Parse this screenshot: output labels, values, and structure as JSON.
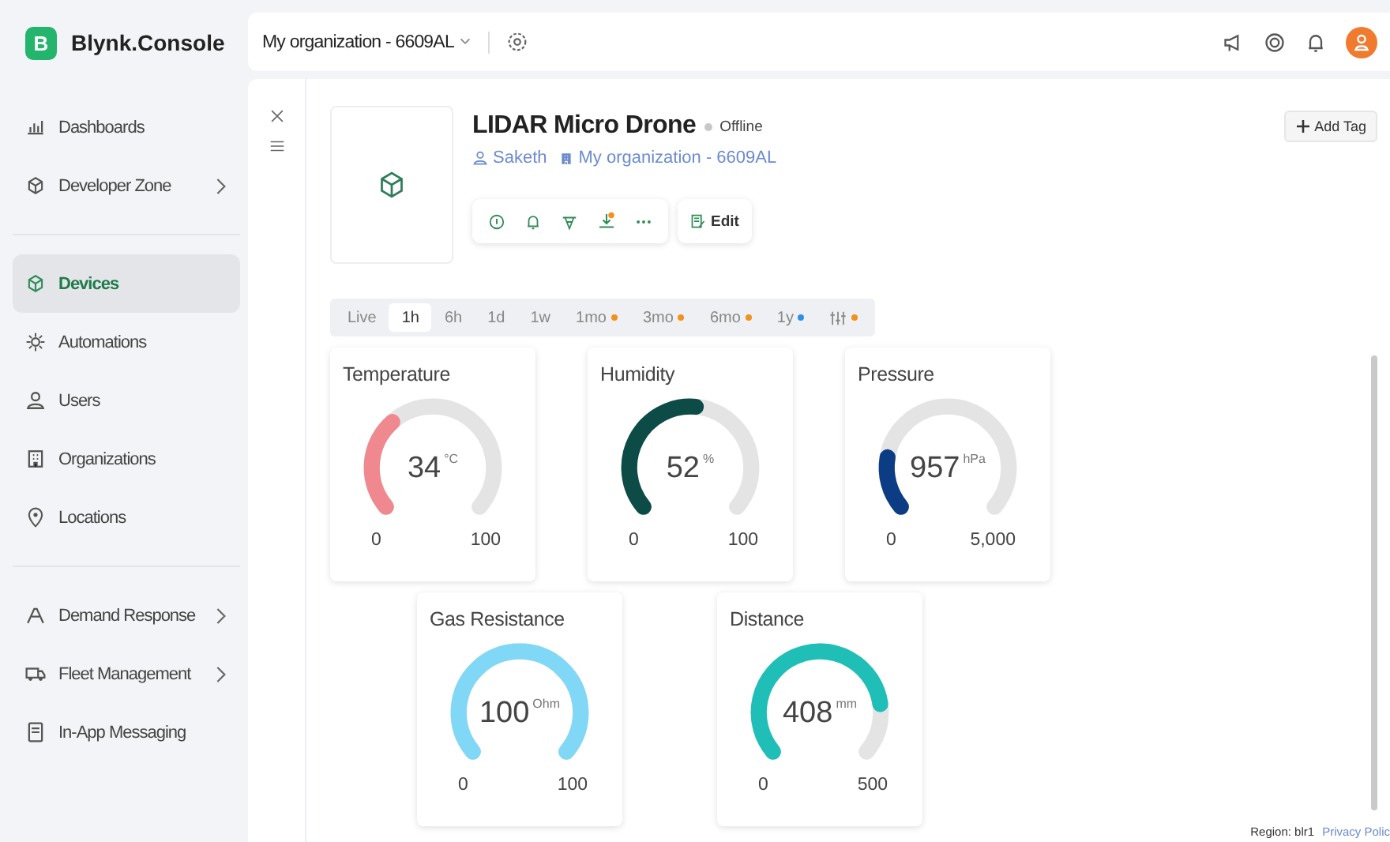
{
  "brand": {
    "logo_letter": "B",
    "name": "Blynk.Console"
  },
  "topbar": {
    "organization": "My organization - 6609AL"
  },
  "sidebar": {
    "groups": [
      [
        {
          "label": "Dashboards",
          "selected": false,
          "expandable": false
        },
        {
          "label": "Developer Zone",
          "selected": false,
          "expandable": true
        }
      ],
      [
        {
          "label": "Devices",
          "selected": true,
          "expandable": false
        },
        {
          "label": "Automations",
          "selected": false,
          "expandable": false
        },
        {
          "label": "Users",
          "selected": false,
          "expandable": false
        },
        {
          "label": "Organizations",
          "selected": false,
          "expandable": false
        },
        {
          "label": "Locations",
          "selected": false,
          "expandable": false
        }
      ],
      [
        {
          "label": "Demand Response",
          "selected": false,
          "expandable": true
        },
        {
          "label": "Fleet Management",
          "selected": false,
          "expandable": true
        },
        {
          "label": "In-App Messaging",
          "selected": false,
          "expandable": false
        }
      ]
    ]
  },
  "device": {
    "name": "LIDAR Micro Drone",
    "status": "Offline",
    "online": false,
    "owner": "Saketh",
    "organization": "My organization - 6609AL",
    "edit_label": "Edit",
    "add_tag_label": "Add Tag"
  },
  "time_ranges": [
    {
      "kind": "text",
      "label": "Live",
      "selected": false
    },
    {
      "kind": "text",
      "label": "1h",
      "selected": true
    },
    {
      "kind": "text",
      "label": "6h",
      "selected": false
    },
    {
      "kind": "text",
      "label": "1d",
      "selected": false
    },
    {
      "kind": "text",
      "label": "1w",
      "selected": false
    },
    {
      "kind": "text",
      "label": "1mo",
      "selected": false,
      "color": "#f0921e"
    },
    {
      "kind": "text",
      "label": "3mo",
      "selected": false,
      "color": "#f0921e"
    },
    {
      "kind": "text",
      "label": "6mo",
      "selected": false,
      "color": "#f0921e"
    },
    {
      "kind": "text",
      "label": "1y",
      "selected": false,
      "color": "#2d8fe6"
    },
    {
      "kind": "icon",
      "selected": false,
      "color": "#f0921e"
    }
  ],
  "widgets": [
    {
      "title": "Temperature",
      "value": "34",
      "unit": "°C",
      "min": "0",
      "max": "100",
      "color": "#f0898f"
    },
    {
      "title": "Humidity",
      "value": "52",
      "unit": "%",
      "min": "0",
      "max": "100",
      "color": "#0d4b47"
    },
    {
      "title": "Pressure",
      "value": "957",
      "unit": "hPa",
      "min": "0",
      "max": "5,000",
      "color": "#0c3c84"
    },
    {
      "title": "Gas Resistance",
      "value": "100",
      "unit": "Ohm",
      "min": "0",
      "max": "100",
      "color": "#80d8f6"
    },
    {
      "title": "Distance",
      "value": "408",
      "unit": "mm",
      "min": "0",
      "max": "500",
      "color": "#1fbfb8"
    }
  ],
  "footer": {
    "region": "Region: blr1",
    "privacy_link": "Privacy Polic"
  }
}
